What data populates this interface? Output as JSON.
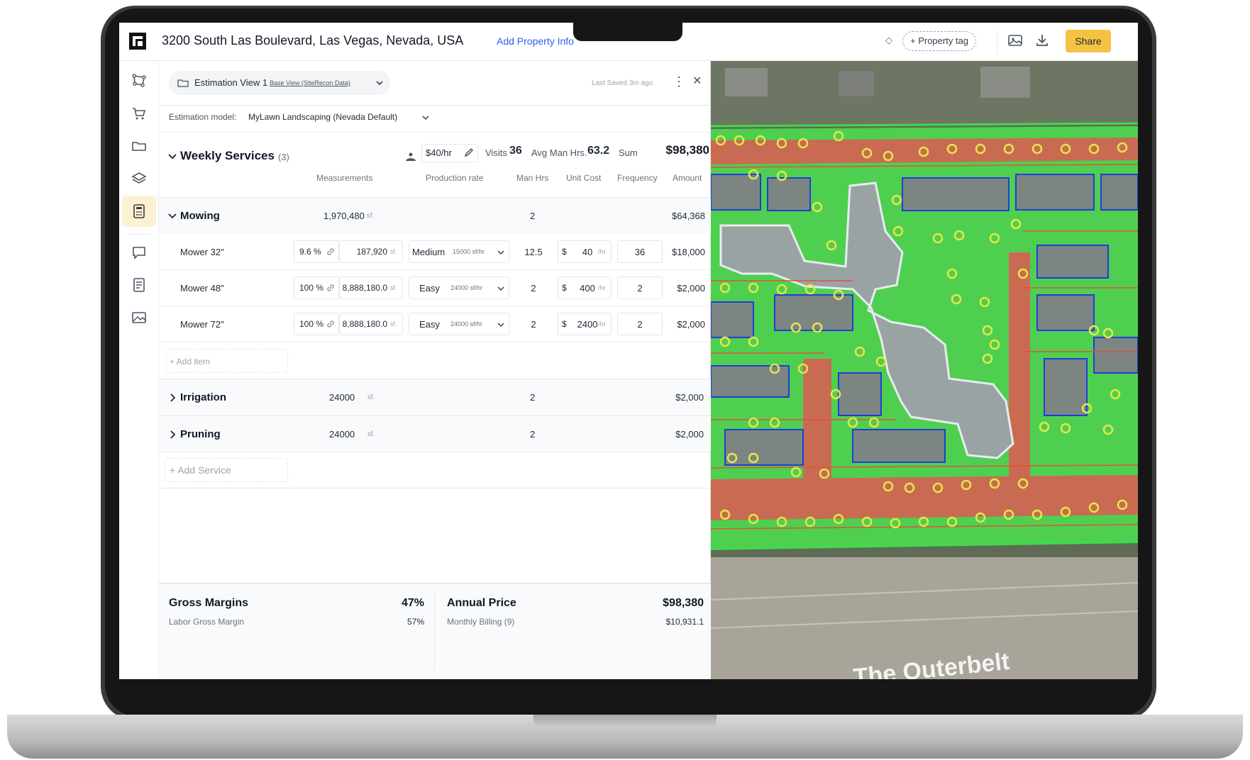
{
  "header": {
    "address": "3200 South Las Boulevard, Las Vegas, Nevada, USA",
    "add_property_info": "Add Property Info",
    "property_tag": "+ Property tag",
    "share": "Share"
  },
  "estimation": {
    "view_name": "Estimation View 1",
    "view_source": "Base View (SiteRecon Data)",
    "last_saved": "Last Saved 3m ago",
    "model_label": "Estimation model:",
    "model_value": "MyLawn Landscaping (Nevada Default)"
  },
  "weekly": {
    "title": "Weekly Services",
    "count": "(3)",
    "rate": "$40/hr",
    "visits_label": "Visits",
    "visits": "36",
    "avg_label": "Avg Man Hrs.",
    "avg": "63.2",
    "sum_label": "Sum",
    "sum": "$98,380"
  },
  "columns": {
    "measurements": "Measurements",
    "production_rate": "Production rate",
    "man_hrs": "Man Hrs",
    "unit_cost": "Unit Cost",
    "frequency": "Frequency",
    "amount": "Amount"
  },
  "mowing": {
    "name": "Mowing",
    "measurement": "1,970,480",
    "unit": "sf.",
    "man_hrs": "2",
    "amount": "$64,368",
    "items": [
      {
        "name": "Mower 32\"",
        "pct": "9.6 %",
        "measurement": "187,920",
        "unit": "sf.",
        "level": "Medium",
        "rate": "15000 sf/hr",
        "man_hrs": "12.5",
        "currency": "$",
        "unit_cost": "40",
        "cost_unit": "/hr",
        "frequency": "36",
        "amount": "$18,000"
      },
      {
        "name": "Mower 48\"",
        "pct": "100 %",
        "measurement": "8,888,180.0",
        "unit": "sf.",
        "level": "Easy",
        "rate": "24000 sf/hr",
        "man_hrs": "2",
        "currency": "$",
        "unit_cost": "400",
        "cost_unit": "/hr",
        "frequency": "2",
        "amount": "$2,000"
      },
      {
        "name": "Mower 72\"",
        "pct": "100 %",
        "measurement": "8,888,180.0",
        "unit": "sf.",
        "level": "Easy",
        "rate": "24000 sf/hr",
        "man_hrs": "2",
        "currency": "$",
        "unit_cost": "2400",
        "cost_unit": "/hr",
        "frequency": "2",
        "amount": "$2,000"
      }
    ],
    "add_item": "+ Add item"
  },
  "irrigation": {
    "name": "Irrigation",
    "measurement": "24000",
    "unit": "sf.",
    "man_hrs": "2",
    "amount": "$2,000"
  },
  "pruning": {
    "name": "Pruning",
    "measurement": "24000",
    "unit": "sf.",
    "man_hrs": "2",
    "amount": "$2,000"
  },
  "add_service": "+ Add Service",
  "footer": {
    "gross_margins": "Gross Margins",
    "gross_pct": "47%",
    "labor_label": "Labor Gross Margin",
    "labor_pct": "57%",
    "annual_price": "Annual Price",
    "annual_value": "$98,380",
    "monthly_label": "Monthly Billing (9)",
    "monthly_value": "$10,931.1"
  },
  "map": {
    "road_label": "The Outerbelt"
  },
  "colors": {
    "accent": "#f6c244",
    "link": "#2563eb",
    "lawn": "#3ddc4a",
    "hardscape": "#e0523a",
    "edge": "#1d3fd6",
    "tree": "#e6e64a"
  }
}
